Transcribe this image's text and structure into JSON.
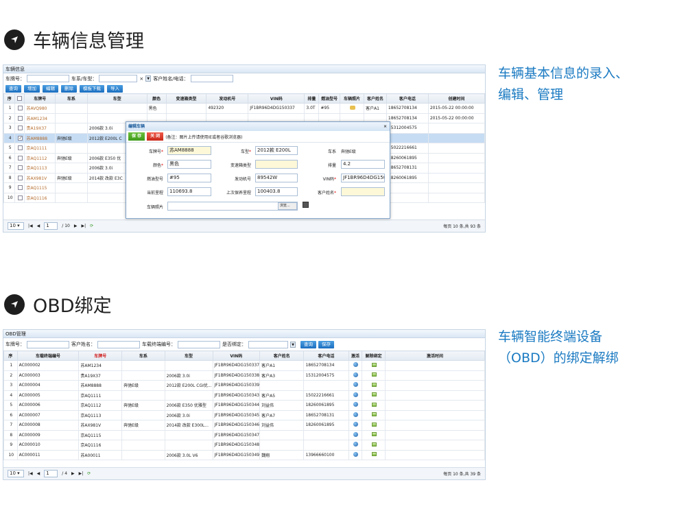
{
  "section1": {
    "title": "车辆信息管理",
    "description_line1": "车辆基本信息的录入、",
    "description_line2": "编辑、管理",
    "panel": {
      "title": "车辆信息",
      "filters": {
        "plate_label": "车牌号：",
        "series_label": "车系/车型：",
        "customer_label": "客户姓名/电话："
      },
      "buttons": [
        "查询",
        "增加",
        "编辑",
        "删除",
        "模板下载",
        "导入"
      ],
      "columns": [
        "序",
        "",
        "车牌号",
        "车系",
        "车型",
        "颜色",
        "变速箱类型",
        "发动机号",
        "VIN码",
        "排量",
        "燃油型号",
        "车辆照片",
        "客户姓名",
        "客户电话",
        "创建时间"
      ],
      "rows": [
        {
          "n": "1",
          "checked": false,
          "plate": "苏AVQ980",
          "series": "",
          "model": "",
          "color": "黑色",
          "gearbox": "",
          "engine": "492320",
          "vin": "JF1BR96D4DG150337",
          "disp": "3.0T",
          "fuel": "#95",
          "photo": true,
          "cname": "客户A1",
          "phone": "18652708134",
          "time": "2015-05-22 00:00:00"
        },
        {
          "n": "2",
          "checked": false,
          "plate": "苏AM1234",
          "series": "",
          "model": "",
          "color": "",
          "gearbox": "",
          "engine": "",
          "vin": "",
          "disp": "",
          "fuel": "",
          "photo": false,
          "cname": "",
          "phone": "18652708134",
          "time": "2015-05-22 00:00:00"
        },
        {
          "n": "3",
          "checked": false,
          "plate": "贵A19X37",
          "series": "",
          "model": "2006款 3.0i",
          "color": "",
          "gearbox": "",
          "engine": "",
          "vin": "",
          "disp": "",
          "fuel": "",
          "photo": false,
          "cname": "",
          "phone": "15312004575",
          "time": ""
        },
        {
          "n": "4",
          "checked": true,
          "plate": "苏AM8888",
          "series": "奔驰E级",
          "model": "2012款 E200L C",
          "color": "",
          "gearbox": "",
          "engine": "",
          "vin": "",
          "disp": "",
          "fuel": "",
          "photo": false,
          "cname": "",
          "phone": "",
          "time": ""
        },
        {
          "n": "5",
          "checked": false,
          "plate": "京AQ1111",
          "series": "",
          "model": "",
          "color": "",
          "gearbox": "",
          "engine": "",
          "vin": "",
          "disp": "",
          "fuel": "",
          "photo": false,
          "cname": "",
          "phone": "15022216661",
          "time": ""
        },
        {
          "n": "6",
          "checked": false,
          "plate": "京AQ1112",
          "series": "奔驰E级",
          "model": "2006款 E350 优",
          "color": "",
          "gearbox": "",
          "engine": "",
          "vin": "",
          "disp": "",
          "fuel": "",
          "photo": false,
          "cname": "",
          "phone": "18260061895",
          "time": ""
        },
        {
          "n": "7",
          "checked": false,
          "plate": "京AQ1113",
          "series": "",
          "model": "2006款 3.0i",
          "color": "",
          "gearbox": "",
          "engine": "",
          "vin": "",
          "disp": "",
          "fuel": "",
          "photo": false,
          "cname": "",
          "phone": "18652708131",
          "time": ""
        },
        {
          "n": "8",
          "checked": false,
          "plate": "苏AX981V",
          "series": "奔驰E级",
          "model": "2014款 改款 E3C",
          "color": "",
          "gearbox": "",
          "engine": "",
          "vin": "",
          "disp": "",
          "fuel": "",
          "photo": false,
          "cname": "",
          "phone": "18260061895",
          "time": ""
        },
        {
          "n": "9",
          "checked": false,
          "plate": "京AQ1115",
          "series": "",
          "model": "",
          "color": "",
          "gearbox": "",
          "engine": "",
          "vin": "",
          "disp": "",
          "fuel": "",
          "photo": false,
          "cname": "",
          "phone": "",
          "time": ""
        },
        {
          "n": "10",
          "checked": false,
          "plate": "京AQ1116",
          "series": "",
          "model": "",
          "color": "",
          "gearbox": "",
          "engine": "",
          "vin": "",
          "disp": "",
          "fuel": "",
          "photo": false,
          "cname": "",
          "phone": "",
          "time": ""
        }
      ],
      "pager": {
        "size": "10",
        "page": "1",
        "total_pages": "/ 10",
        "summary": "每页 10 条,共 93 条"
      },
      "dialog": {
        "title": "编辑车辆",
        "save": "保 存",
        "close": "关 闭",
        "note": "(备注：图片上传请使用IE或者谷歌浏览器)",
        "fields": {
          "plate_label": "车牌号",
          "plate": "苏AM8888",
          "model_label": "车型",
          "model": "2012款 E200L",
          "series_label": "车系",
          "series": "奔驰E级",
          "color_label": "颜色",
          "color": "黑色",
          "gearbox_label": "变速箱类型",
          "gearbox": "",
          "disp_label": "排量",
          "disp": "4.2",
          "fuel_label": "燃油型号",
          "fuel": "#95",
          "engine_label": "发动机号",
          "engine": "89542W",
          "vin_label": "VIN码",
          "vin": "JF1BR96D4DG150",
          "mileage_label": "当前里程",
          "mileage": "110693.8",
          "last_label": "上次保养里程",
          "last": "100403.8",
          "cname_label": "客户姓名",
          "cname": "",
          "photo_label": "车辆照片",
          "browse": "浏览..."
        }
      }
    }
  },
  "section2": {
    "title": "OBD绑定",
    "description_line1": "车辆智能终端设备",
    "description_line2": "（OBD）的绑定解绑",
    "panel": {
      "title": "OBD管理",
      "filters": {
        "plate_label": "车牌号：",
        "customer_label": "客户姓名：",
        "terminal_label": "车载终端编号：",
        "bound_label": "是否绑定："
      },
      "buttons": [
        "查询",
        "保存"
      ],
      "columns": [
        "序",
        "车载终端编号",
        "车牌号",
        "车系",
        "车型",
        "VIN码",
        "客户姓名",
        "客户电话",
        "激活",
        "解除绑定",
        "激活时间"
      ],
      "rows": [
        {
          "n": "1",
          "term": "AC000002",
          "plate": "苏AM1234",
          "series": "",
          "model": "",
          "vin": "JF1BR96D4DG150337",
          "cname": "客户A1",
          "phone": "18652708134"
        },
        {
          "n": "2",
          "term": "AC000003",
          "plate": "贵A19X37",
          "series": "",
          "model": "2006款 3.0i",
          "vin": "JF1BR96D4DG150338",
          "cname": "客户A3",
          "phone": "15312004575"
        },
        {
          "n": "3",
          "term": "AC000004",
          "plate": "苏AM8888",
          "series": "奔驰E级",
          "model": "2012款 E200L CGI优...",
          "vin": "JF1BR96D4DG150339",
          "cname": "",
          "phone": ""
        },
        {
          "n": "4",
          "term": "AC000005",
          "plate": "京AQ1111",
          "series": "",
          "model": "",
          "vin": "JF1BR96D4DG150343",
          "cname": "客户A5",
          "phone": "15022216661"
        },
        {
          "n": "5",
          "term": "AC000006",
          "plate": "京AQ1112",
          "series": "奔驰E级",
          "model": "2006款 E350 优雅型",
          "vin": "JF1BR96D4DG150344",
          "cname": "刘益伟",
          "phone": "18260061895"
        },
        {
          "n": "6",
          "term": "AC000007",
          "plate": "京AQ1113",
          "series": "",
          "model": "2006款 3.0i",
          "vin": "JF1BR96D4DG150345",
          "cname": "客户A7",
          "phone": "18652708131"
        },
        {
          "n": "7",
          "term": "AC000008",
          "plate": "苏AX981V",
          "series": "奔驰E级",
          "model": "2014款 改款 E300L...",
          "vin": "JF1BR96D4DG150346",
          "cname": "刘益伟",
          "phone": "18260061895"
        },
        {
          "n": "8",
          "term": "AC000009",
          "plate": "京AQ1115",
          "series": "",
          "model": "",
          "vin": "JF1BR96D4DG150347",
          "cname": "",
          "phone": ""
        },
        {
          "n": "9",
          "term": "AC000010",
          "plate": "京AQ1116",
          "series": "",
          "model": "",
          "vin": "JF1BR96D4DG150348",
          "cname": "",
          "phone": ""
        },
        {
          "n": "10",
          "term": "AC000011",
          "plate": "苏A00011",
          "series": "",
          "model": "2006款 3.0L V6",
          "vin": "JF1BR96D4DG150349",
          "cname": "魏翔",
          "phone": "13966660100"
        }
      ],
      "pager": {
        "size": "10",
        "page": "1",
        "total_pages": "/ 4",
        "summary": "每页 10 条,共 39 条"
      }
    }
  },
  "colors": {
    "accent": "#1a7ac2",
    "button": "#1c6fc0",
    "selected_row": "#c6dcf3",
    "plate_link": "#b36a2a"
  }
}
